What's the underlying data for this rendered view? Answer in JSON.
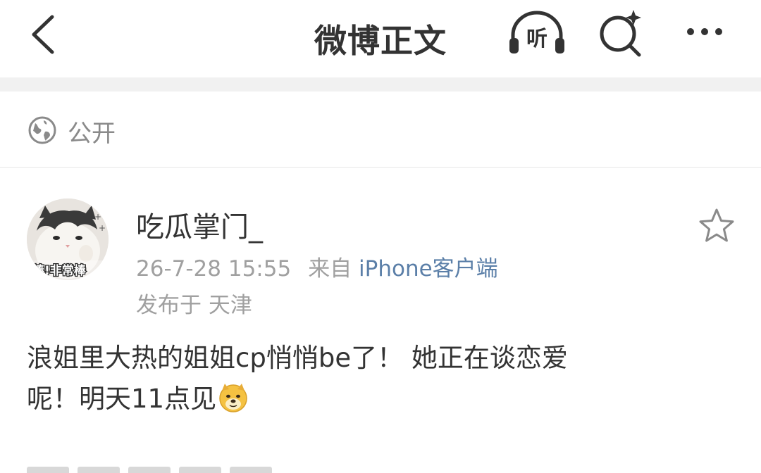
{
  "nav": {
    "title": "微博正文",
    "listen_label": "听"
  },
  "visibility": {
    "label": "公开"
  },
  "post": {
    "author_name": "吃瓜掌门_",
    "timestamp": "26-7-28 15:55",
    "source_prefix": "来自",
    "source_link": "iPhone客户端",
    "location": "发布于 天津",
    "avatar_caption": "棒!非常棒",
    "text_line1": "浪姐里大热的姐姐cp悄悄be了！ 她正在谈恋爱",
    "text_line2": "呢！明天11点见",
    "emoji": "doge-emoji"
  },
  "colors": {
    "text_primary": "#333333",
    "text_secondary": "#a0a0a0",
    "link": "#5b7fa8",
    "separator": "#f1f1f1",
    "emoji_yellow": "#f5c242"
  }
}
